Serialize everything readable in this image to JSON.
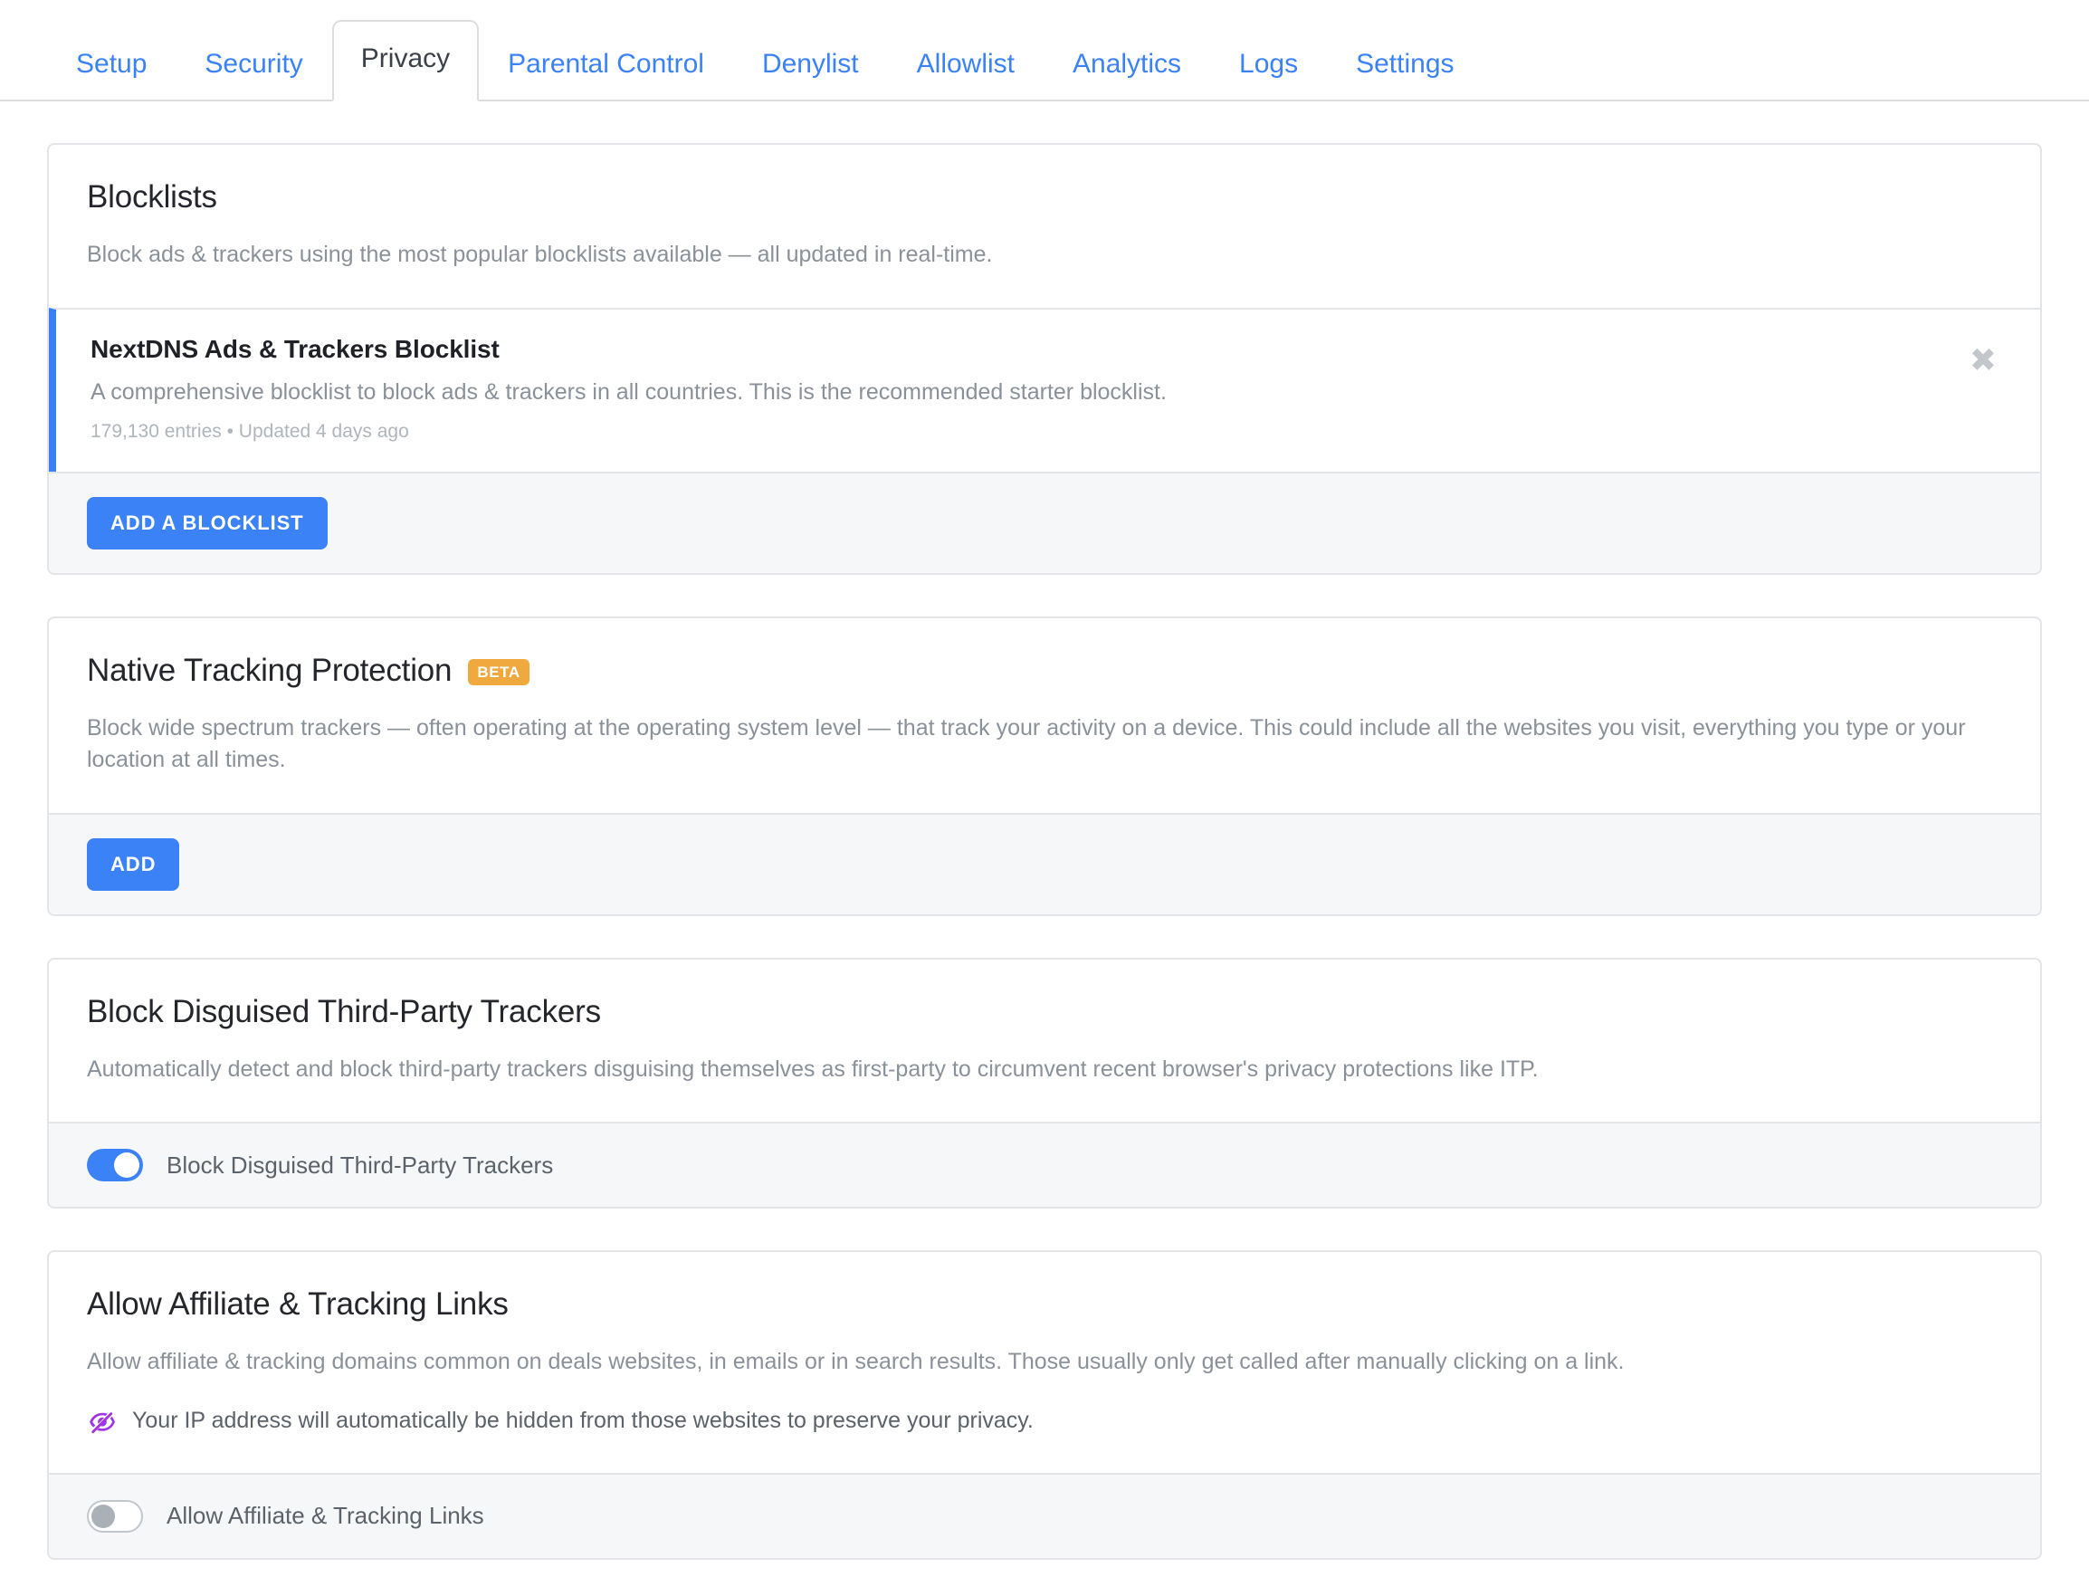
{
  "tabs": [
    {
      "label": "Setup",
      "active": false
    },
    {
      "label": "Security",
      "active": false
    },
    {
      "label": "Privacy",
      "active": true
    },
    {
      "label": "Parental Control",
      "active": false
    },
    {
      "label": "Denylist",
      "active": false
    },
    {
      "label": "Allowlist",
      "active": false
    },
    {
      "label": "Analytics",
      "active": false
    },
    {
      "label": "Logs",
      "active": false
    },
    {
      "label": "Settings",
      "active": false
    }
  ],
  "colors": {
    "accent_blue": "#3b82f6",
    "accent_bar_blue": "#3b7ff5",
    "beta_orange": "#f0a93f",
    "eye_purple": "#a033e8",
    "strip_gray": "#f6f7f8"
  },
  "blocklists": {
    "title": "Blocklists",
    "description": "Block ads & trackers using the most popular blocklists available — all updated in real-time.",
    "items": [
      {
        "name": "NextDNS Ads & Trackers Blocklist",
        "description": "A comprehensive blocklist to block ads & trackers in all countries. This is the recommended starter blocklist.",
        "meta": "179,130 entries • Updated 4 days ago",
        "remove_icon": "close-icon"
      }
    ],
    "add_button": "ADD A BLOCKLIST"
  },
  "native_tracking": {
    "title": "Native Tracking Protection",
    "badge": "BETA",
    "description": "Block wide spectrum trackers — often operating at the operating system level — that track your activity on a device. This could include all the websites you visit, everything you type or your location at all times.",
    "add_button": "ADD"
  },
  "disguised_trackers": {
    "title": "Block Disguised Third-Party Trackers",
    "description": "Automatically detect and block third-party trackers disguising themselves as first-party to circumvent recent browser's privacy protections like ITP.",
    "toggle_label": "Block Disguised Third-Party Trackers",
    "toggle_state": "on"
  },
  "affiliate_links": {
    "title": "Allow Affiliate & Tracking Links",
    "description": "Allow affiliate & tracking domains common on deals websites, in emails or in search results. Those usually only get called after manually clicking on a link.",
    "note_icon": "eye-slash-icon",
    "note": "Your IP address will automatically be hidden from those websites to preserve your privacy.",
    "toggle_label": "Allow Affiliate & Tracking Links",
    "toggle_state": "off"
  }
}
